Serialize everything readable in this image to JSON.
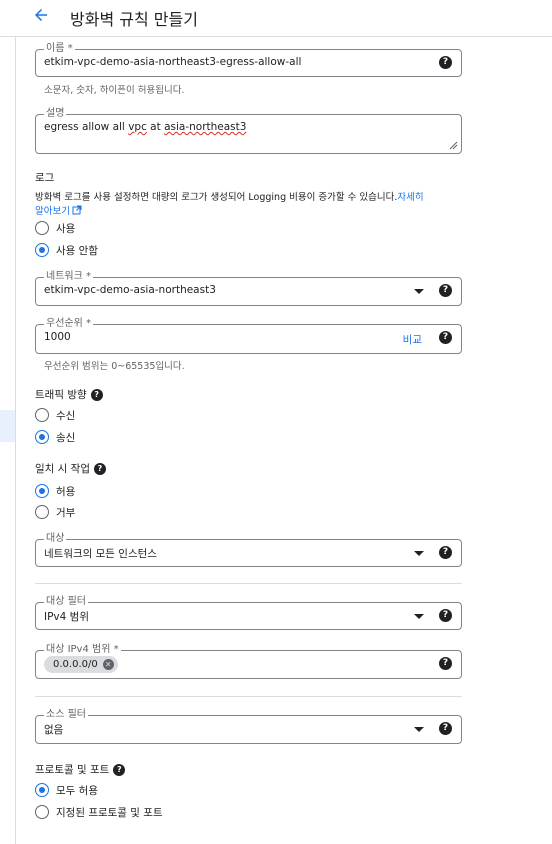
{
  "header": {
    "title": "방화벽 규칙 만들기"
  },
  "name_field": {
    "label": "이름 *",
    "value": "etkim-vpc-demo-asia-northeast3-egress-allow-all",
    "hint": "소문자, 숫자, 하이픈이 허용됩니다."
  },
  "desc_field": {
    "label": "설명",
    "value_prefix": "egress allow all ",
    "value_vpc": "vpc",
    "value_mid": " at ",
    "value_region": "asia-northeast3"
  },
  "logs": {
    "title": "로그",
    "text": "방화벽 로그를 사용 설정하면 대량의 로그가 생성되어 Logging 비용이 증가할 수 있습니다.",
    "link1": "자세히",
    "link2": "알아보기",
    "options": [
      "사용",
      "사용 안함"
    ]
  },
  "network_field": {
    "label": "네트워크 *",
    "value": "etkim-vpc-demo-asia-northeast3"
  },
  "priority_field": {
    "label": "우선순위 *",
    "value": "1000",
    "compare": "비교",
    "hint": "우선순위 범위는 0~65535입니다."
  },
  "traffic": {
    "title": "트래픽 방향",
    "options": [
      "수신",
      "송신"
    ]
  },
  "action": {
    "title": "일치 시 작업",
    "options": [
      "허용",
      "거부"
    ]
  },
  "target_field": {
    "label": "대상",
    "value": "네트워크의 모든 인스턴스"
  },
  "dest_filter_field": {
    "label": "대상 필터",
    "value": "IPv4 범위"
  },
  "dest_ipv4_field": {
    "label": "대상 IPv4 범위 *",
    "chip": "0.0.0.0/0"
  },
  "source_filter_field": {
    "label": "소스 필터",
    "value": "없음"
  },
  "protocols": {
    "title": "프로토콜 및 포트",
    "options": [
      "모두 허용",
      "지정된 프로토콜 및 포트"
    ]
  },
  "colors": {
    "accent": "#1a73e8",
    "border": "#80868b",
    "text": "#202124",
    "hint": "#5f6368"
  },
  "icons": {
    "back": "arrow-back-icon",
    "help": "help-icon",
    "dropdown": "chevron-down-icon",
    "chip_remove": "cancel-icon"
  }
}
